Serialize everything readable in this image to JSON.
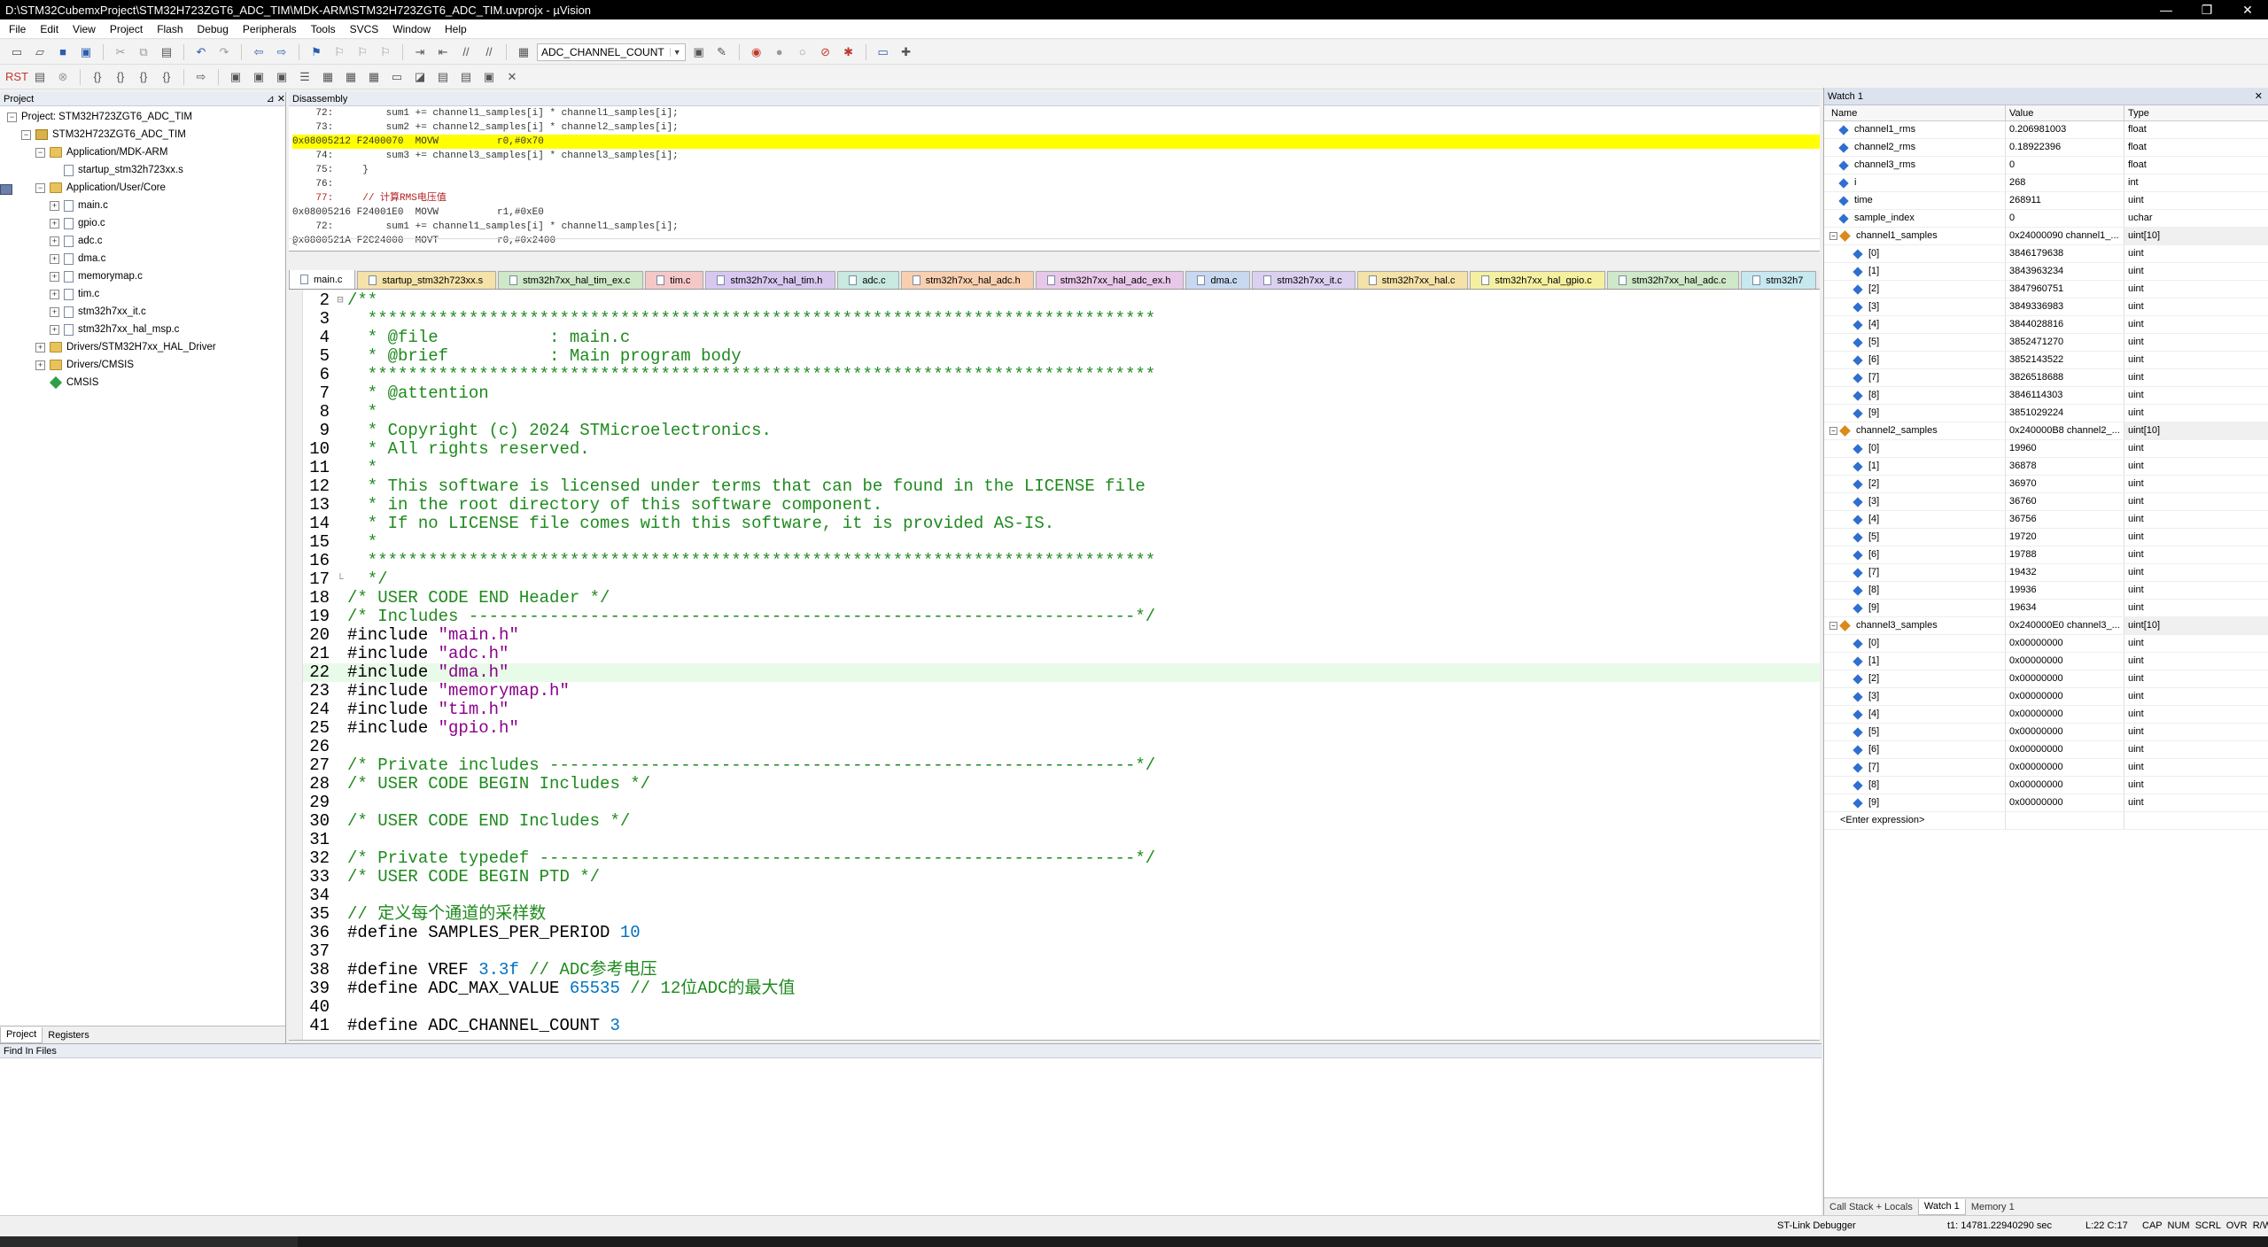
{
  "window": {
    "title": "D:\\STM32CubemxProject\\STM32H723ZGT6_ADC_TIM\\MDK-ARM\\STM32H723ZGT6_ADC_TIM.uvprojx - µVision",
    "min_label": "—",
    "max_label": "❐",
    "close_label": "✕"
  },
  "menu": [
    "File",
    "Edit",
    "View",
    "Project",
    "Flash",
    "Debug",
    "Peripherals",
    "Tools",
    "SVCS",
    "Window",
    "Help"
  ],
  "toolbar": {
    "target_combo": "ADC_CHANNEL_COUNT"
  },
  "project_panel": {
    "title": "Project",
    "pin": "⊿ ✕",
    "tree": [
      {
        "label": "Project: STM32H723ZGT6_ADC_TIM",
        "level": 0,
        "icon": "proj",
        "exp": "−"
      },
      {
        "label": "STM32H723ZGT6_ADC_TIM",
        "level": 1,
        "icon": "target",
        "exp": "−"
      },
      {
        "label": "Application/MDK-ARM",
        "level": 2,
        "icon": "folder",
        "exp": "−"
      },
      {
        "label": "startup_stm32h723xx.s",
        "level": 3,
        "icon": "file",
        "exp": ""
      },
      {
        "label": "Application/User/Core",
        "level": 2,
        "icon": "folder",
        "exp": "−"
      },
      {
        "label": "main.c",
        "level": 3,
        "icon": "file",
        "exp": "+"
      },
      {
        "label": "gpio.c",
        "level": 3,
        "icon": "file",
        "exp": "+"
      },
      {
        "label": "adc.c",
        "level": 3,
        "icon": "file",
        "exp": "+"
      },
      {
        "label": "dma.c",
        "level": 3,
        "icon": "file",
        "exp": "+"
      },
      {
        "label": "memorymap.c",
        "level": 3,
        "icon": "file",
        "exp": "+"
      },
      {
        "label": "tim.c",
        "level": 3,
        "icon": "file",
        "exp": "+"
      },
      {
        "label": "stm32h7xx_it.c",
        "level": 3,
        "icon": "file",
        "exp": "+"
      },
      {
        "label": "stm32h7xx_hal_msp.c",
        "level": 3,
        "icon": "file",
        "exp": "+"
      },
      {
        "label": "Drivers/STM32H7xx_HAL_Driver",
        "level": 2,
        "icon": "folder",
        "exp": "+"
      },
      {
        "label": "Drivers/CMSIS",
        "level": 2,
        "icon": "folder",
        "exp": "+"
      },
      {
        "label": "CMSIS",
        "level": 2,
        "icon": "cmsis",
        "exp": ""
      }
    ],
    "tabs": [
      "Project",
      "Registers"
    ]
  },
  "disassembly": {
    "title": "Disassembly",
    "lines": [
      {
        "text": "    72:         sum1 += channel1_samples[i] * channel1_samples[i];",
        "hl": false
      },
      {
        "text": "    73:         sum2 += channel2_samples[i] * channel2_samples[i];",
        "hl": false
      },
      {
        "text": "0x08005212 F2400070  MOVW          r0,#0x70",
        "hl": true
      },
      {
        "text": "    74:         sum3 += channel3_samples[i] * channel3_samples[i];",
        "hl": false
      },
      {
        "text": "    75:     }",
        "hl": false
      },
      {
        "text": "    76:",
        "hl": false
      },
      {
        "text": "    77:     // 计算RMS电压值",
        "hl": false
      },
      {
        "text": "0x08005216 F24001E0  MOVW          r1,#0xE0",
        "hl": false
      },
      {
        "text": "    72:         sum1 += channel1_samples[i] * channel1_samples[i];",
        "hl": false
      },
      {
        "text": "0x0800521A F2C24000  MOVT          r0,#0x2400",
        "hl": false
      }
    ],
    "scroll_arrow": "<"
  },
  "file_tabs": [
    {
      "label": "main.c",
      "color": "#ffffff",
      "active": true
    },
    {
      "label": "startup_stm32h723xx.s",
      "color": "#f5e2a8"
    },
    {
      "label": "stm32h7xx_hal_tim_ex.c",
      "color": "#cfe8c8"
    },
    {
      "label": "tim.c",
      "color": "#f5c8c8"
    },
    {
      "label": "stm32h7xx_hal_tim.h",
      "color": "#d8c8f0"
    },
    {
      "label": "adc.c",
      "color": "#c8e8e0"
    },
    {
      "label": "stm32h7xx_hal_adc.h",
      "color": "#f8d0b0"
    },
    {
      "label": "stm32h7xx_hal_adc_ex.h",
      "color": "#e8c8e8"
    },
    {
      "label": "dma.c",
      "color": "#c8d8f0"
    },
    {
      "label": "stm32h7xx_it.c",
      "color": "#dcd0f0"
    },
    {
      "label": "stm32h7xx_hal.c",
      "color": "#f5e2a8"
    },
    {
      "label": "stm32h7xx_hal_gpio.c",
      "color": "#f5f0a0"
    },
    {
      "label": "stm32h7xx_hal_adc.c",
      "color": "#cfe8c8"
    },
    {
      "label": "stm32h7",
      "color": "#c8e8f0"
    }
  ],
  "code_lines": [
    {
      "n": "2",
      "t": "/**",
      "k": "c",
      "f": "⊟"
    },
    {
      "n": "3",
      "t": "  ******************************************************************************",
      "k": "c"
    },
    {
      "n": "4",
      "t": "  * @file           : main.c",
      "k": "c"
    },
    {
      "n": "5",
      "t": "  * @brief          : Main program body",
      "k": "c"
    },
    {
      "n": "6",
      "t": "  ******************************************************************************",
      "k": "c"
    },
    {
      "n": "7",
      "t": "  * @attention",
      "k": "c"
    },
    {
      "n": "8",
      "t": "  *",
      "k": "c"
    },
    {
      "n": "9",
      "t": "  * Copyright (c) 2024 STMicroelectronics.",
      "k": "c"
    },
    {
      "n": "10",
      "t": "  * All rights reserved.",
      "k": "c"
    },
    {
      "n": "11",
      "t": "  *",
      "k": "c"
    },
    {
      "n": "12",
      "t": "  * This software is licensed under terms that can be found in the LICENSE file",
      "k": "c"
    },
    {
      "n": "13",
      "t": "  * in the root directory of this software component.",
      "k": "c"
    },
    {
      "n": "14",
      "t": "  * If no LICENSE file comes with this software, it is provided AS-IS.",
      "k": "c"
    },
    {
      "n": "15",
      "t": "  *",
      "k": "c"
    },
    {
      "n": "16",
      "t": "  ******************************************************************************",
      "k": "c"
    },
    {
      "n": "17",
      "t": "  */",
      "k": "c",
      "f": "└"
    },
    {
      "n": "18",
      "t": "/* USER CODE END Header */",
      "k": "c"
    },
    {
      "n": "19",
      "t": "/* Includes ------------------------------------------------------------------*/",
      "k": "c"
    },
    {
      "n": "20",
      "pre": "#include ",
      "str": "\"main.h\"",
      "k": "inc"
    },
    {
      "n": "21",
      "pre": "#include ",
      "str": "\"adc.h\"",
      "k": "inc"
    },
    {
      "n": "22",
      "pre": "#include ",
      "str": "\"dma.h\"",
      "k": "inc",
      "cur": true
    },
    {
      "n": "23",
      "pre": "#include ",
      "str": "\"memorymap.h\"",
      "k": "inc"
    },
    {
      "n": "24",
      "pre": "#include ",
      "str": "\"tim.h\"",
      "k": "inc"
    },
    {
      "n": "25",
      "pre": "#include ",
      "str": "\"gpio.h\"",
      "k": "inc"
    },
    {
      "n": "26",
      "t": "",
      "k": "p"
    },
    {
      "n": "27",
      "t": "/* Private includes ----------------------------------------------------------*/",
      "k": "c"
    },
    {
      "n": "28",
      "t": "/* USER CODE BEGIN Includes */",
      "k": "c"
    },
    {
      "n": "29",
      "t": "",
      "k": "p"
    },
    {
      "n": "30",
      "t": "/* USER CODE END Includes */",
      "k": "c"
    },
    {
      "n": "31",
      "t": "",
      "k": "p"
    },
    {
      "n": "32",
      "t": "/* Private typedef -----------------------------------------------------------*/",
      "k": "c"
    },
    {
      "n": "33",
      "t": "/* USER CODE BEGIN PTD */",
      "k": "c"
    },
    {
      "n": "34",
      "t": "",
      "k": "p"
    },
    {
      "n": "35",
      "t": "// 定义每个通道的采样数",
      "k": "c"
    },
    {
      "n": "36",
      "pre": "#define SAMPLES_PER_PERIOD ",
      "num": "10",
      "k": "def"
    },
    {
      "n": "37",
      "t": "",
      "k": "p"
    },
    {
      "n": "38",
      "pre": "#define VREF ",
      "num": "3.3f",
      "post": " // ADC参考电压",
      "k": "def"
    },
    {
      "n": "39",
      "pre": "#define ADC_MAX_VALUE ",
      "num": "65535",
      "post": " // 12位ADC的最大值",
      "k": "def"
    },
    {
      "n": "40",
      "t": "",
      "k": "p"
    },
    {
      "n": "41",
      "pre": "#define ADC_CHANNEL_COUNT ",
      "num": "3",
      "k": "def"
    }
  ],
  "find_panel": {
    "title": "Find In Files"
  },
  "watch": {
    "title": "Watch 1",
    "close": "✕",
    "cols": {
      "name": "Name",
      "value": "Value",
      "type": "Type"
    },
    "rows": [
      {
        "name": "channel1_rms",
        "value": "0.206981003",
        "type": "float",
        "lvl": 0,
        "icon": "var"
      },
      {
        "name": "channel2_rms",
        "value": "0.18922396",
        "type": "float",
        "lvl": 0,
        "icon": "var"
      },
      {
        "name": "channel3_rms",
        "value": "0",
        "type": "float",
        "lvl": 0,
        "icon": "var"
      },
      {
        "name": "i",
        "value": "268",
        "type": "int",
        "lvl": 0,
        "icon": "var"
      },
      {
        "name": "time",
        "value": "268911",
        "type": "uint",
        "lvl": 0,
        "icon": "var"
      },
      {
        "name": "sample_index",
        "value": "0",
        "type": "uchar",
        "lvl": 0,
        "icon": "var"
      },
      {
        "name": "channel1_samples",
        "value": "0x24000090 channel1_...",
        "type": "uint[10]",
        "lvl": 0,
        "icon": "struct",
        "exp": "−"
      },
      {
        "name": "[0]",
        "value": "3846179638",
        "type": "uint",
        "lvl": 1,
        "icon": "var"
      },
      {
        "name": "[1]",
        "value": "3843963234",
        "type": "uint",
        "lvl": 1,
        "icon": "var"
      },
      {
        "name": "[2]",
        "value": "3847960751",
        "type": "uint",
        "lvl": 1,
        "icon": "var"
      },
      {
        "name": "[3]",
        "value": "3849336983",
        "type": "uint",
        "lvl": 1,
        "icon": "var"
      },
      {
        "name": "[4]",
        "value": "3844028816",
        "type": "uint",
        "lvl": 1,
        "icon": "var"
      },
      {
        "name": "[5]",
        "value": "3852471270",
        "type": "uint",
        "lvl": 1,
        "icon": "var"
      },
      {
        "name": "[6]",
        "value": "3852143522",
        "type": "uint",
        "lvl": 1,
        "icon": "var"
      },
      {
        "name": "[7]",
        "value": "3826518688",
        "type": "uint",
        "lvl": 1,
        "icon": "var"
      },
      {
        "name": "[8]",
        "value": "3846114303",
        "type": "uint",
        "lvl": 1,
        "icon": "var"
      },
      {
        "name": "[9]",
        "value": "3851029224",
        "type": "uint",
        "lvl": 1,
        "icon": "var"
      },
      {
        "name": "channel2_samples",
        "value": "0x240000B8 channel2_...",
        "type": "uint[10]",
        "lvl": 0,
        "icon": "struct",
        "exp": "−"
      },
      {
        "name": "[0]",
        "value": "19960",
        "type": "uint",
        "lvl": 1,
        "icon": "var"
      },
      {
        "name": "[1]",
        "value": "36878",
        "type": "uint",
        "lvl": 1,
        "icon": "var"
      },
      {
        "name": "[2]",
        "value": "36970",
        "type": "uint",
        "lvl": 1,
        "icon": "var"
      },
      {
        "name": "[3]",
        "value": "36760",
        "type": "uint",
        "lvl": 1,
        "icon": "var"
      },
      {
        "name": "[4]",
        "value": "36756",
        "type": "uint",
        "lvl": 1,
        "icon": "var"
      },
      {
        "name": "[5]",
        "value": "19720",
        "type": "uint",
        "lvl": 1,
        "icon": "var"
      },
      {
        "name": "[6]",
        "value": "19788",
        "type": "uint",
        "lvl": 1,
        "icon": "var"
      },
      {
        "name": "[7]",
        "value": "19432",
        "type": "uint",
        "lvl": 1,
        "icon": "var"
      },
      {
        "name": "[8]",
        "value": "19936",
        "type": "uint",
        "lvl": 1,
        "icon": "var"
      },
      {
        "name": "[9]",
        "value": "19634",
        "type": "uint",
        "lvl": 1,
        "icon": "var"
      },
      {
        "name": "channel3_samples",
        "value": "0x240000E0 channel3_...",
        "type": "uint[10]",
        "lvl": 0,
        "icon": "struct",
        "exp": "−"
      },
      {
        "name": "[0]",
        "value": "0x00000000",
        "type": "uint",
        "lvl": 1,
        "icon": "var"
      },
      {
        "name": "[1]",
        "value": "0x00000000",
        "type": "uint",
        "lvl": 1,
        "icon": "var"
      },
      {
        "name": "[2]",
        "value": "0x00000000",
        "type": "uint",
        "lvl": 1,
        "icon": "var"
      },
      {
        "name": "[3]",
        "value": "0x00000000",
        "type": "uint",
        "lvl": 1,
        "icon": "var"
      },
      {
        "name": "[4]",
        "value": "0x00000000",
        "type": "uint",
        "lvl": 1,
        "icon": "var"
      },
      {
        "name": "[5]",
        "value": "0x00000000",
        "type": "uint",
        "lvl": 1,
        "icon": "var"
      },
      {
        "name": "[6]",
        "value": "0x00000000",
        "type": "uint",
        "lvl": 1,
        "icon": "var"
      },
      {
        "name": "[7]",
        "value": "0x00000000",
        "type": "uint",
        "lvl": 1,
        "icon": "var"
      },
      {
        "name": "[8]",
        "value": "0x00000000",
        "type": "uint",
        "lvl": 1,
        "icon": "var"
      },
      {
        "name": "[9]",
        "value": "0x00000000",
        "type": "uint",
        "lvl": 1,
        "icon": "var"
      },
      {
        "name": "<Enter expression>",
        "value": "",
        "type": "",
        "lvl": 0,
        "icon": "none"
      }
    ],
    "tabs": [
      "Call Stack + Locals",
      "Watch 1",
      "Memory 1"
    ]
  },
  "status": {
    "debugger": "ST-Link Debugger",
    "time": "t1: 14781.22940290 sec",
    "pos": "L:22 C:17",
    "flags": "CAP  NUM  SCRL  OVR  R/W"
  }
}
